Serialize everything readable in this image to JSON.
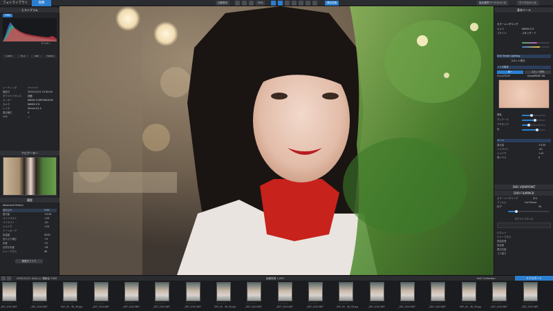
{
  "topbar": {
    "tabs": [
      {
        "label": "フォトライブラリ"
      },
      {
        "label": "現像"
      }
    ],
    "center_buttons": [
      {
        "label": "比較表示"
      },
      {
        "label": "100"
      },
      {
        "label": "補正前後"
      }
    ],
    "right_buttons": [
      {
        "label": "複合選択ワークスペース"
      },
      {
        "label": "ワークスペース"
      }
    ]
  },
  "left": {
    "histogram_title": "ヒストグラム",
    "hist_mode": "RGB",
    "hist_channels": "R G B L",
    "exif_rows": [
      {
        "k": "シャッター",
        "v": "1/125"
      },
      {
        "k": "絞り",
        "v": "F1.4"
      },
      {
        "k": "ISO",
        "v": "400"
      },
      {
        "k": "焦点距離",
        "v": "50mm"
      }
    ],
    "info_rows": [
      {
        "k": "レーティング",
        "v": "☆☆☆☆☆"
      },
      {
        "k": "撮影日",
        "v": "2022/12/11 15:30:00"
      },
      {
        "k": "ホワイトバランス",
        "v": "自動"
      },
      {
        "k": "メーカー",
        "v": "NIKON CORPORATION"
      },
      {
        "k": "カメラ",
        "v": "NIKON Z 6"
      },
      {
        "k": "レンズ",
        "v": "50mm f/1.4"
      },
      {
        "k": "露出補正",
        "v": "0"
      },
      {
        "k": "GPS",
        "v": "—"
      }
    ],
    "nav_title": "ナビゲーター",
    "history_title": "履歴",
    "history_label": "Advanced History",
    "history_items": [
      {
        "label": "読み込み",
        "v": "0.00"
      },
      {
        "label": "露光量",
        "v": "+0.30"
      },
      {
        "label": "コントラスト",
        "v": "+10"
      },
      {
        "label": "ハイライト",
        "v": "-20"
      },
      {
        "label": "シャドウ",
        "v": "+15"
      },
      {
        "label": "トーンカーブ",
        "v": ""
      },
      {
        "label": "色温度",
        "v": "5200"
      },
      {
        "label": "色かぶり補正",
        "v": "+3"
      },
      {
        "label": "彩度",
        "v": "+5"
      },
      {
        "label": "自然な彩度",
        "v": "+8"
      },
      {
        "label": "シャープネス",
        "v": "40"
      }
    ],
    "bottom_button": "履歴をクリア"
  },
  "right": {
    "basic_title": "基本ツール",
    "color_rendering": "カラーレンダリング",
    "color_rows": [
      {
        "k": "カメラ",
        "v": "NIKON Z 6"
      },
      {
        "k": "スタイル",
        "v": "スタンダード"
      }
    ],
    "lighting_title": "DxO Smart Lighting",
    "lighting_mode": "スポット測光",
    "lighting_options": [
      "均一",
      "スポット測光"
    ],
    "denoise_title": "ノイズ除去",
    "denoise_options": [
      "DeepPRIME",
      "DeepPRIME XD"
    ],
    "sliders": [
      {
        "k": "輝度",
        "v": 40
      },
      {
        "k": "ディテール",
        "v": 55
      },
      {
        "k": "デモザイク",
        "v": 30
      },
      {
        "k": "色",
        "v": 65
      }
    ],
    "tone_title": "トーン",
    "tone_rows": [
      {
        "k": "露光量",
        "v": "+0.30"
      },
      {
        "k": "ハイライト",
        "v": "-20"
      },
      {
        "k": "シャドウ",
        "v": "+15"
      },
      {
        "k": "黒レベル",
        "v": "0"
      }
    ],
    "viewpoint_title": "DXO VIEWPOINT",
    "filmpack_title": "DXO FILMPACK",
    "filmpack_rows": [
      {
        "k": "カラーレンダリング",
        "v": "ポジ"
      },
      {
        "k": "フィルム",
        "v": "Fuji Provia"
      },
      {
        "k": "粒子",
        "v": "20"
      }
    ],
    "wb_title": "ホワイトバランス",
    "bottom_rows": [
      {
        "k": "ビネット"
      },
      {
        "k": "シャープネス"
      },
      {
        "k": "歪曲収差"
      },
      {
        "k": "色収差"
      },
      {
        "k": "周辺光量"
      },
      {
        "k": "ゴミ取り"
      }
    ],
    "export_button": "エクスポート"
  },
  "filmbar": {
    "path": "2022/12/11 かわいい 撮影会 2500",
    "count_label": "画像枚数",
    "count": "1,093",
    "filter": "DxO Collection",
    "export_label": "エクスポート"
  },
  "film": [
    {
      "name": "_DSF_2040.NEF"
    },
    {
      "name": "_DSF_2040.NEF"
    },
    {
      "name": "DSF_00 - 98_36.jpg"
    },
    {
      "name": "_DSF_2040.NEF"
    },
    {
      "name": "_DSF_2040.NEF"
    },
    {
      "name": "_DSF_2040.NEF"
    },
    {
      "name": "_DSF_2040.NEF"
    },
    {
      "name": "DSF_00 - 98_36.jpg"
    },
    {
      "name": "_DSF_2040.NEF"
    },
    {
      "name": "_DSF_2040.NEF"
    },
    {
      "name": "_DSF_2040.NEF"
    },
    {
      "name": "DSF_00 - 98_36.jpg"
    },
    {
      "name": "_DSF_2040.NEF"
    },
    {
      "name": "_DSF_2040.NEF"
    },
    {
      "name": "_DSF_2040.NEF"
    },
    {
      "name": "DSF_00 - 98_36.jpg"
    },
    {
      "name": "_DSF_2040.NEF"
    },
    {
      "name": "_DSF_2040.NEF"
    }
  ],
  "colors": {
    "accent": "#2b7fd0",
    "panel": "#232428",
    "dark": "#1b1c1f"
  },
  "icons": [
    "app-logo-icon",
    "grid-icon",
    "compare-icon",
    "crop-icon",
    "brush-icon",
    "eye-dropper-icon",
    "settings-icon",
    "close-icon"
  ]
}
